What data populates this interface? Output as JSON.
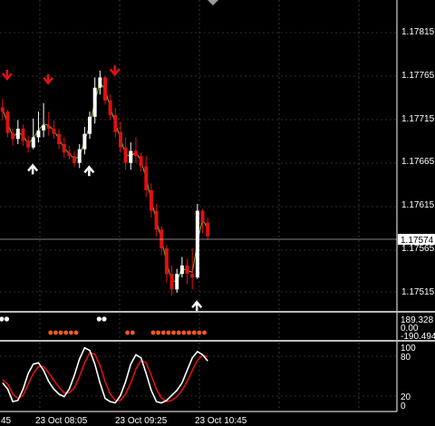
{
  "window": {
    "title": ""
  },
  "main_chart": {
    "price_ticks": [
      "1.17815",
      "1.17765",
      "1.17715",
      "1.17665",
      "1.17615",
      "1.17565",
      "1.17515"
    ],
    "current_price": "1.17574",
    "bid_line_color": "#ffffff"
  },
  "indicator_1": {
    "ticks": [
      "189.328",
      "0.00",
      "-190.494"
    ],
    "dot_color_sell": "#ff5a1f",
    "dot_color_buy": "#ffffff"
  },
  "indicator_2": {
    "ticks": [
      "100",
      "80",
      "20",
      "0"
    ],
    "main_line_color": "#ffffff",
    "signal_line_color": "#e01010"
  },
  "time_axis": {
    "labels": [
      "45",
      "23 Oct 08:05",
      "23 Oct 09:25",
      "23 Oct 10:45"
    ]
  },
  "markers": {
    "sell_arrow_color": "#e01010",
    "buy_arrow_color": "#ffffff"
  },
  "scroll_icon": "chart-shift-marker-icon",
  "chart_data": {
    "type": "candlestick",
    "title": "",
    "ylim": [
      1.1749,
      1.1784
    ],
    "ma_color": "#7bbf2a",
    "bull_color": "#ffffff",
    "bear_color": "#e01010",
    "candles": [
      [
        1.17725,
        1.17735,
        1.1771,
        1.1772
      ],
      [
        1.1772,
        1.17722,
        1.1769,
        1.17695
      ],
      [
        1.17695,
        1.177,
        1.1768,
        1.17688
      ],
      [
        1.17688,
        1.1771,
        1.17682,
        1.177
      ],
      [
        1.177,
        1.17705,
        1.1768,
        1.17686
      ],
      [
        1.17686,
        1.17692,
        1.17672,
        1.17678
      ],
      [
        1.17678,
        1.17712,
        1.17676,
        1.1769
      ],
      [
        1.1769,
        1.1772,
        1.17684,
        1.17698
      ],
      [
        1.17698,
        1.1773,
        1.1769,
        1.17704
      ],
      [
        1.17704,
        1.1772,
        1.17692,
        1.177
      ],
      [
        1.177,
        1.1771,
        1.17688,
        1.17694
      ],
      [
        1.17694,
        1.177,
        1.17676,
        1.17682
      ],
      [
        1.17682,
        1.1769,
        1.17666,
        1.17672
      ],
      [
        1.17672,
        1.1768,
        1.17664,
        1.17668
      ],
      [
        1.17668,
        1.17674,
        1.17655,
        1.1766
      ],
      [
        1.1766,
        1.17682,
        1.17654,
        1.17676
      ],
      [
        1.17676,
        1.17702,
        1.1767,
        1.17694
      ],
      [
        1.17694,
        1.1772,
        1.17688,
        1.17714
      ],
      [
        1.17714,
        1.1776,
        1.17706,
        1.17748
      ],
      [
        1.17748,
        1.17768,
        1.1774,
        1.1776
      ],
      [
        1.1776,
        1.17762,
        1.17728,
        1.17733
      ],
      [
        1.17733,
        1.1774,
        1.1771,
        1.17716
      ],
      [
        1.17716,
        1.17724,
        1.1769,
        1.17696
      ],
      [
        1.17696,
        1.17708,
        1.17672,
        1.17678
      ],
      [
        1.17678,
        1.1769,
        1.17652,
        1.1766
      ],
      [
        1.1766,
        1.17684,
        1.17652,
        1.17674
      ],
      [
        1.17674,
        1.1769,
        1.1766,
        1.17668
      ],
      [
        1.17668,
        1.17672,
        1.1765,
        1.17656
      ],
      [
        1.17656,
        1.17668,
        1.1762,
        1.17628
      ],
      [
        1.17628,
        1.17636,
        1.17596,
        1.17604
      ],
      [
        1.17604,
        1.17612,
        1.17574,
        1.17582
      ],
      [
        1.17582,
        1.17586,
        1.17552,
        1.1756
      ],
      [
        1.1756,
        1.17564,
        1.1752,
        1.1753
      ],
      [
        1.1753,
        1.1754,
        1.17505,
        1.17512
      ],
      [
        1.17512,
        1.17536,
        1.17508,
        1.1753
      ],
      [
        1.1753,
        1.1755,
        1.17526,
        1.1754
      ],
      [
        1.1754,
        1.17548,
        1.17518,
        1.1753
      ],
      [
        1.1753,
        1.1756,
        1.17512,
        1.17526
      ],
      [
        1.17526,
        1.17612,
        1.17524,
        1.17604
      ],
      [
        1.17604,
        1.17606,
        1.17578,
        1.1759
      ],
      [
        1.1759,
        1.17596,
        1.1757,
        1.17574
      ]
    ],
    "sell_arrows_at": [
      0,
      8,
      21
    ],
    "buy_arrows_at": [
      5,
      16,
      37
    ],
    "indicator_dots": {
      "buy_at": [
        0,
        1,
        19,
        20
      ],
      "sell_at": [
        9,
        10,
        11,
        12,
        13,
        14,
        24,
        25,
        29,
        30,
        31,
        32,
        33,
        34,
        35,
        36,
        37,
        38,
        39
      ]
    },
    "stochastic": {
      "main": [
        40,
        30,
        10,
        12,
        30,
        55,
        70,
        72,
        60,
        42,
        30,
        22,
        18,
        30,
        52,
        78,
        96,
        92,
        70,
        40,
        15,
        10,
        8,
        20,
        42,
        70,
        85,
        80,
        55,
        28,
        10,
        8,
        12,
        20,
        28,
        40,
        60,
        80,
        90,
        85,
        75
      ],
      "signal": [
        45,
        38,
        22,
        15,
        20,
        38,
        55,
        66,
        66,
        56,
        44,
        33,
        24,
        24,
        32,
        50,
        72,
        88,
        86,
        68,
        42,
        22,
        12,
        12,
        22,
        40,
        62,
        76,
        72,
        52,
        30,
        16,
        10,
        12,
        18,
        28,
        42,
        60,
        76,
        84,
        82
      ]
    }
  }
}
